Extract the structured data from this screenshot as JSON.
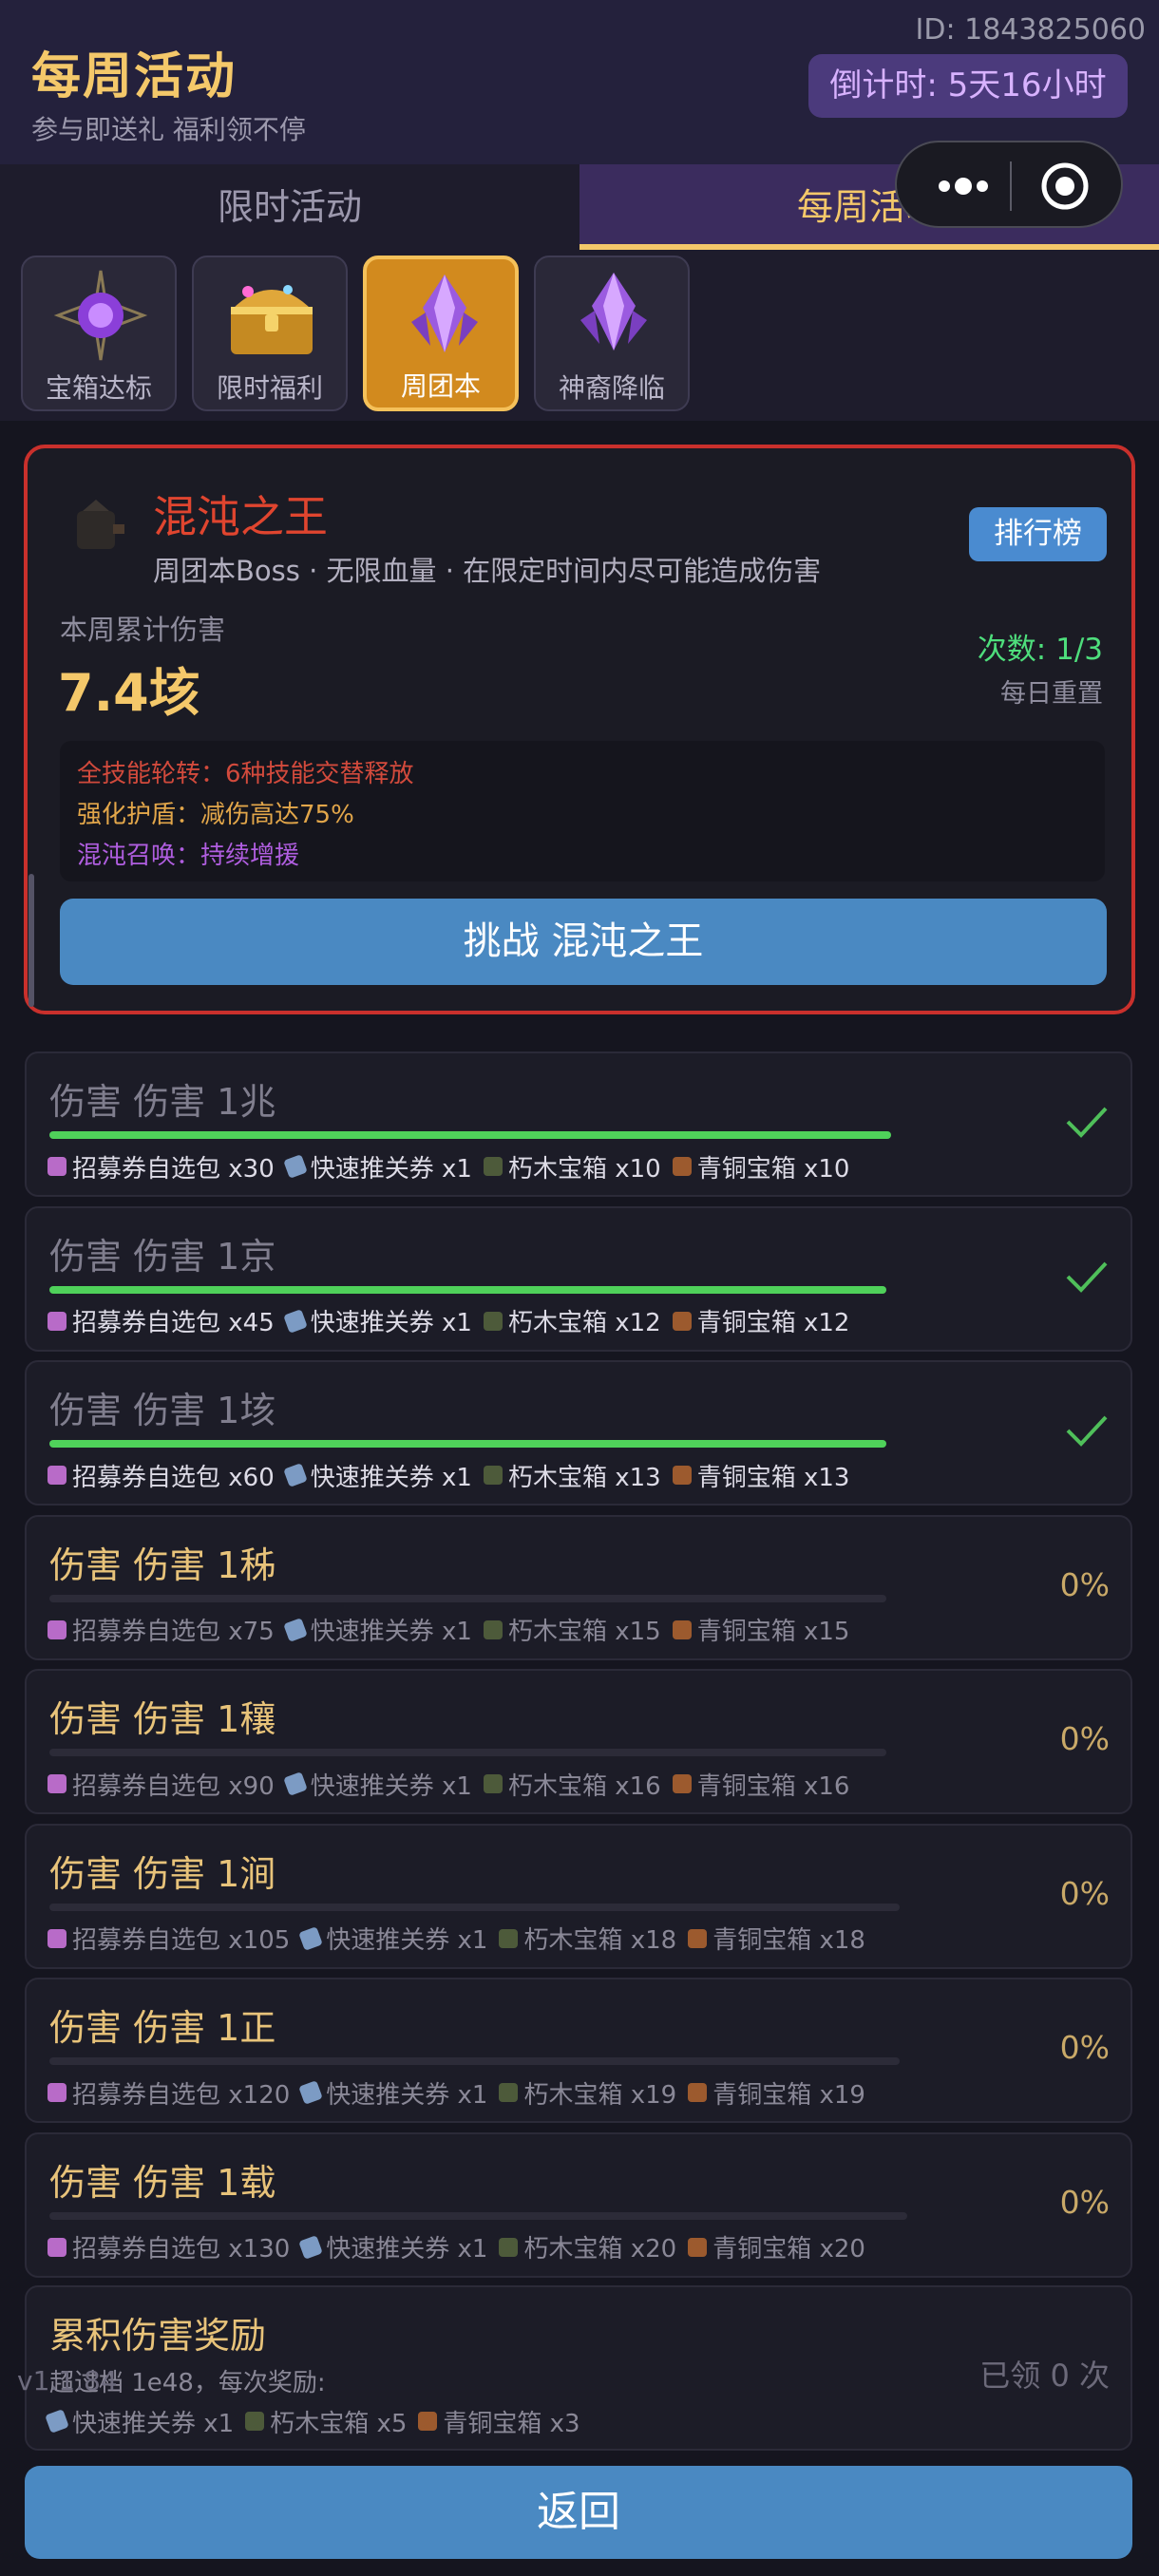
{
  "header": {
    "id_text": "ID: 1843825060",
    "title": "每周活动",
    "subtitle": "参与即送礼 福利领不停",
    "countdown": "倒计时: 5天16小时"
  },
  "tabs": [
    {
      "label": "限时活动"
    },
    {
      "label": "每周活动"
    }
  ],
  "categories": [
    {
      "label": "宝箱达标"
    },
    {
      "label": "限时福利"
    },
    {
      "label": "周团本"
    },
    {
      "label": "神裔降临"
    }
  ],
  "boss": {
    "name": "混沌之王",
    "desc": "周团本Boss · 无限血量 · 在限定时间内尽可能造成伤害",
    "rank_label": "排行榜",
    "damage_label": "本周累计伤害",
    "damage_value": "7.4垓",
    "tries": "次数: 1/3",
    "reset": "每日重置",
    "skills": [
      "全技能轮转：6种技能交替释放",
      "强化护盾：减伤高达75%",
      "混沌召唤：持续增援"
    ],
    "challenge_label": "挑战 混沌之王"
  },
  "rows": [
    {
      "title": "伤害 伤害 1兆",
      "status": "done",
      "progress": 1.0,
      "rewards": [
        "招募券自选包 x30",
        "快速推关券 x1",
        "朽木宝箱 x10",
        "青铜宝箱 x10"
      ]
    },
    {
      "title": "伤害 伤害 1京",
      "status": "done",
      "progress": 1.0,
      "rewards": [
        "招募券自选包 x45",
        "快速推关券 x1",
        "朽木宝箱 x12",
        "青铜宝箱 x12"
      ]
    },
    {
      "title": "伤害 伤害 1垓",
      "status": "done",
      "progress": 1.0,
      "rewards": [
        "招募券自选包 x60",
        "快速推关券 x1",
        "朽木宝箱 x13",
        "青铜宝箱 x13"
      ]
    },
    {
      "title": "伤害 伤害 1秭",
      "status": "todo",
      "progress": 0.0,
      "pct": "0%",
      "rewards": [
        "招募券自选包 x75",
        "快速推关券 x1",
        "朽木宝箱 x15",
        "青铜宝箱 x15"
      ]
    },
    {
      "title": "伤害 伤害 1穰",
      "status": "todo",
      "progress": 0.0,
      "pct": "0%",
      "rewards": [
        "招募券自选包 x90",
        "快速推关券 x1",
        "朽木宝箱 x16",
        "青铜宝箱 x16"
      ]
    },
    {
      "title": "伤害 伤害 1涧",
      "status": "todo",
      "progress": 0.0,
      "pct": "0%",
      "rewards": [
        "招募券自选包 x105",
        "快速推关券 x1",
        "朽木宝箱 x18",
        "青铜宝箱 x18"
      ]
    },
    {
      "title": "伤害 伤害 1正",
      "status": "todo",
      "progress": 0.0,
      "pct": "0%",
      "rewards": [
        "招募券自选包 x120",
        "快速推关券 x1",
        "朽木宝箱 x19",
        "青铜宝箱 x19"
      ]
    },
    {
      "title": "伤害 伤害 1载",
      "status": "todo",
      "progress": 0.0,
      "pct": "0%",
      "rewards": [
        "招募券自选包 x130",
        "快速推关券 x1",
        "朽木宝箱 x20",
        "青铜宝箱 x20"
      ]
    }
  ],
  "accum": {
    "title": "累积伤害奖励",
    "desc": "超过档 1e48，每次奖励:",
    "rewards": [
      "快速推关券 x1",
      "朽木宝箱 x5",
      "青铜宝箱 x3"
    ],
    "claimed": "已领 0 次"
  },
  "version": "v1.1.84",
  "back_label": "返回"
}
